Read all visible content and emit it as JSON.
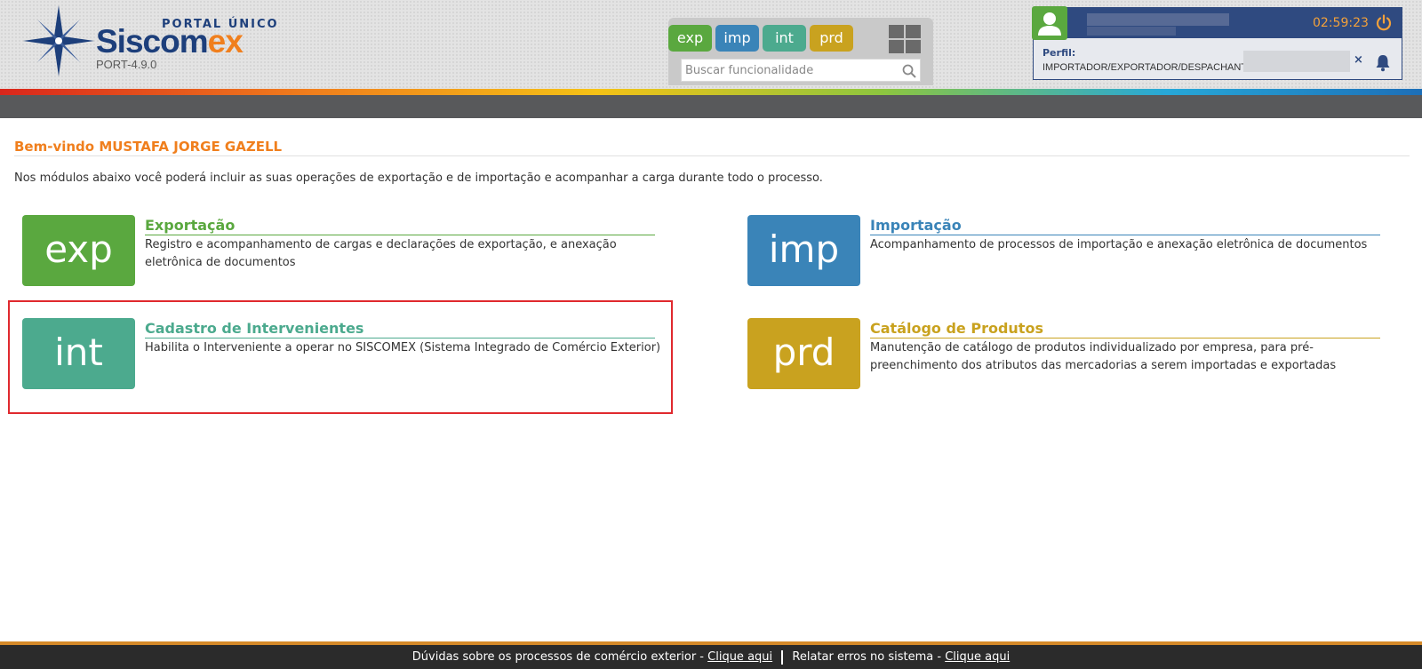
{
  "header": {
    "portal_label": "PORTAL ÚNICO",
    "brand_main": "Siscom",
    "brand_accent": "ex",
    "version": "PORT-4.9.0",
    "modules": [
      {
        "label": "exp",
        "color": "#5aa83f"
      },
      {
        "label": "imp",
        "color": "#3a84b8"
      },
      {
        "label": "int",
        "color": "#4caa8e"
      },
      {
        "label": "prd",
        "color": "#c9a21f"
      }
    ],
    "search": {
      "placeholder": "Buscar funcionalidade"
    }
  },
  "user": {
    "session_timer": "02:59:23",
    "perfil_label": "Perfil:",
    "perfil_value": "IMPORTADOR/EXPORTADOR/DESPACHANTE",
    "close_label": "×"
  },
  "main": {
    "welcome": "Bem-vindo MUSTAFA JORGE GAZELL",
    "intro": "Nos módulos abaixo você poderá incluir as suas operações de exportação e de importação e acompanhar a carga durante todo o processo.",
    "cards": [
      {
        "tile": "exp",
        "title": "Exportação",
        "description": "Registro e acompanhamento de cargas e declarações de exportação, e anexação eletrônica de documentos",
        "color": "#5aa83f"
      },
      {
        "tile": "imp",
        "title": "Importação",
        "description": "Acompanhamento de processos de importação e anexação eletrônica de documentos",
        "color": "#3a84b8"
      },
      {
        "tile": "int",
        "title": "Cadastro de Intervenientes",
        "description": "Habilita o Interveniente a operar no SISCOMEX (Sistema Integrado de Comércio Exterior)",
        "color": "#4caa8e"
      },
      {
        "tile": "prd",
        "title": "Catálogo de Produtos",
        "description": "Manutenção de catálogo de produtos individualizado por empresa, para pré-preenchimento dos atributos das mercadorias a serem importadas e exportadas",
        "color": "#c9a21f"
      }
    ]
  },
  "footer": {
    "question_text": "Dúvidas sobre os processos de comércio exterior -",
    "link1": "Clique aqui",
    "report_text": "Relatar erros no sistema -",
    "link2": "Clique aqui"
  },
  "colors": {
    "brand_blue": "#1d3f7b",
    "accent_orange": "#f07f1d",
    "highlight_red": "#e0292e"
  }
}
